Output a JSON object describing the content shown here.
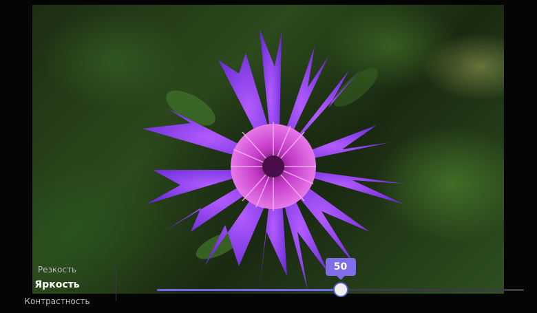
{
  "settings_menu": {
    "items": [
      {
        "label": "Резкость"
      },
      {
        "label": "Яркость"
      },
      {
        "label": "Контрастность"
      }
    ],
    "selected_index": 1
  },
  "slider": {
    "value": 50,
    "value_label": "50",
    "min": 0,
    "max": 100
  },
  "colors": {
    "accent": "#6f67e6",
    "bubble": "#7f6ee8",
    "track": "#3c3c44"
  }
}
